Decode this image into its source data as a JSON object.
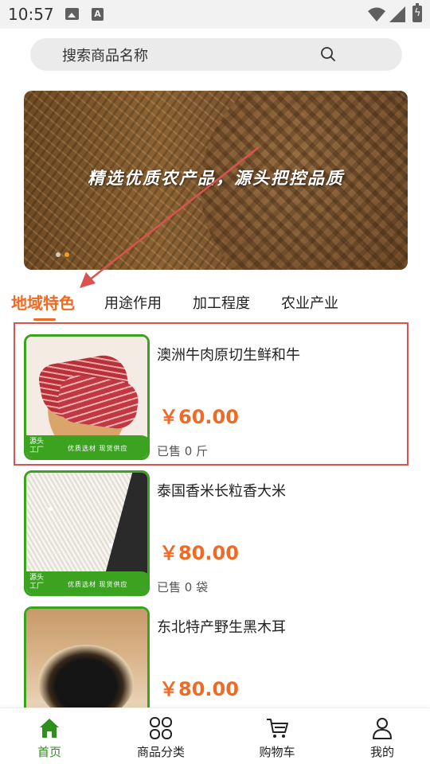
{
  "status_bar": {
    "time": "10:57",
    "font_badge": "A",
    "battery_glyph": "ϟ"
  },
  "search": {
    "placeholder": "搜索商品名称"
  },
  "banner": {
    "slogan": "精选优质农产品，源头把控品质"
  },
  "tabs": [
    {
      "label": "地域特色",
      "active": true
    },
    {
      "label": "用途作用",
      "active": false
    },
    {
      "label": "加工程度",
      "active": false
    },
    {
      "label": "农业产业",
      "active": false
    }
  ],
  "products": [
    {
      "name": "澳洲牛肉原切生鲜和牛",
      "price": "￥60.00",
      "sold": "已售 0 斤",
      "image_icon": "beef-image"
    },
    {
      "name": "泰国香米长粒香大米",
      "price": "￥80.00",
      "sold": "已售 0 袋",
      "image_icon": "rice-image"
    },
    {
      "name": "东北特产野生黑木耳",
      "price": "￥80.00",
      "sold": "",
      "image_icon": "fungus-image"
    }
  ],
  "thumb_label": {
    "source": "源头工厂",
    "slogan": "优质选材 现货供应"
  },
  "bottom_nav": [
    {
      "label": "首页",
      "icon": "home-icon",
      "active": true
    },
    {
      "label": "商品分类",
      "icon": "grid-icon",
      "active": false
    },
    {
      "label": "购物车",
      "icon": "cart-icon",
      "active": false
    },
    {
      "label": "我的",
      "icon": "user-icon",
      "active": false
    }
  ],
  "colors": {
    "accent": "#f26a22",
    "price": "#ef6b25",
    "green": "#3ba320",
    "nav_active": "#2f8f1f",
    "annotation": "#d9534f"
  }
}
